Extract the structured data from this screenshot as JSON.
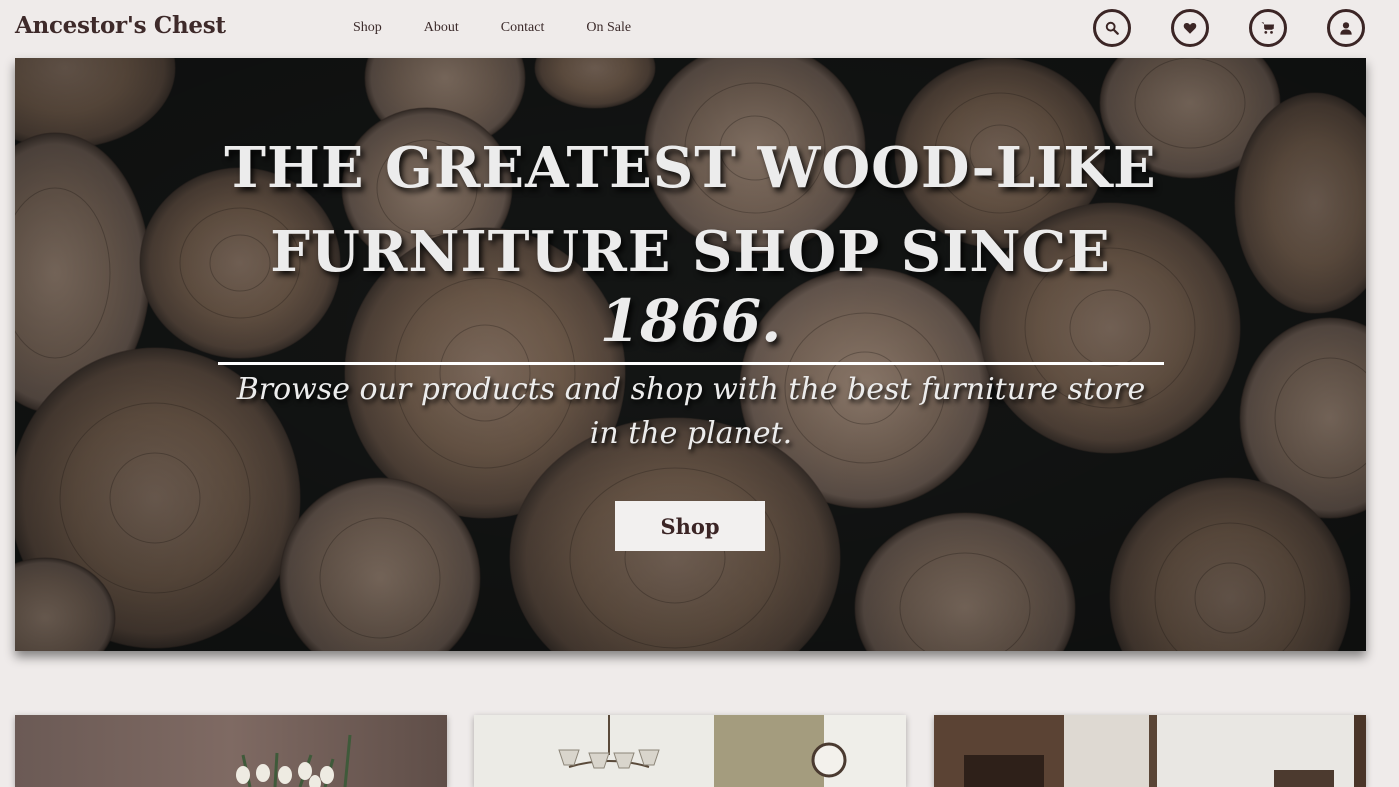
{
  "brand": {
    "name": "Ancestor's Chest"
  },
  "nav": {
    "items": [
      "Shop",
      "About",
      "Contact",
      "On Sale"
    ]
  },
  "icons": {
    "search": "search-icon",
    "wishlist": "heart-icon",
    "cart": "cart-icon",
    "account": "user-icon"
  },
  "hero": {
    "headline_line1": "THE GREATEST WOOD-LIKE",
    "headline_line2": "FURNITURE SHOP SINCE",
    "year": "1866.",
    "subtitle": "Browse our products and shop with the best furniture store in the planet.",
    "cta_label": "Shop"
  },
  "colors": {
    "background": "#efebea",
    "brand_text": "#3e2a2a",
    "icon_stroke": "#3b2525",
    "hero_text": "#ececec",
    "button_bg": "#f2f0ef"
  }
}
